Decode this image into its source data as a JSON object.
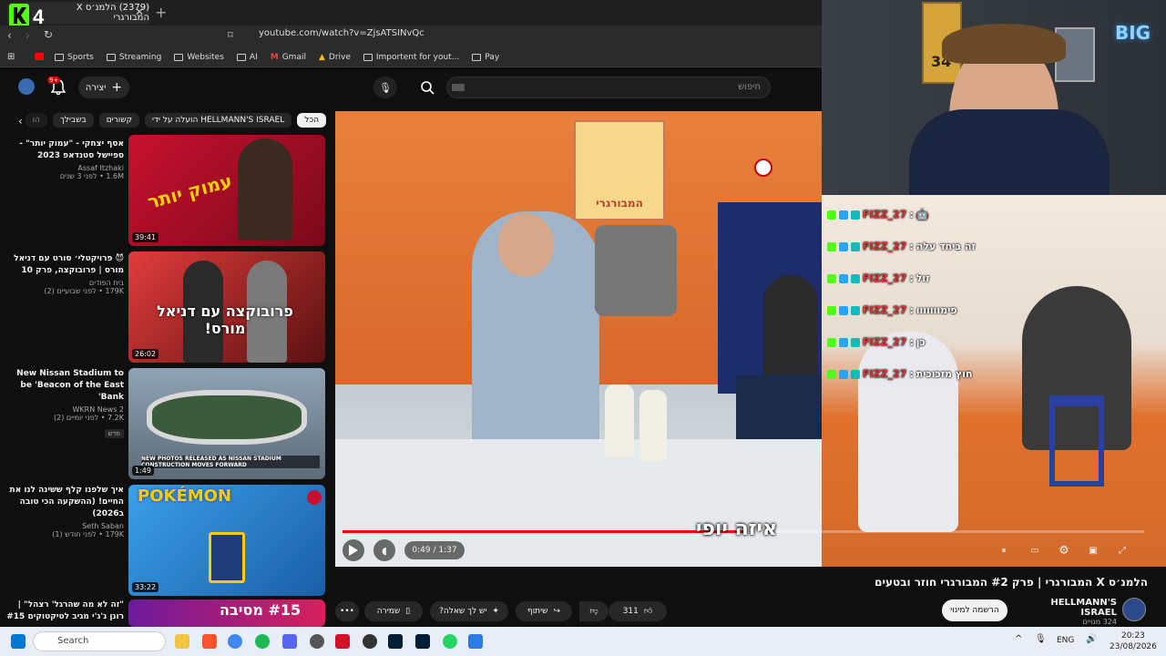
{
  "browser": {
    "tab_title": "(2379) הלמנ׳ס X המבורגרי",
    "address": "youtube.com/watch?v=ZjsATSINvQc",
    "bookmarks": [
      "Sports",
      "Streaming",
      "Websites",
      "AI",
      "Gmail",
      "Drive",
      "Importent for yout...",
      "Pay"
    ]
  },
  "header": {
    "search_placeholder": "חיפוש",
    "create_label": "יצירה",
    "notif_count": "9+"
  },
  "chips": [
    "הכל",
    "HELLMANN'S ISRAEL הועלה על ידי",
    "קשורים",
    "בשבילך",
    "הו"
  ],
  "related": [
    {
      "title": "אסף יצחקי - \"עמוק יותר\" - ספיישל סטנדאפ 2023",
      "channel": "Assaf Itzhaki",
      "stats": "1.6M  •  לפני 3 שנים",
      "duration": "39:41",
      "thumb_text": "עמוק יותר"
    },
    {
      "title": "😈 פרויקטלי׳ סורט עם דניאל מורס | פרובוקצה, פרק 10",
      "channel": "בית הפודים",
      "stats": "179K  •  לפני שבועיים (2)",
      "duration": "26:02",
      "thumb_text": "פרובוקצה עם דניאל מורס!"
    },
    {
      "title": "New Nissan Stadium to be 'Beacon of the East Bank'",
      "channel": "WKRN News 2",
      "stats": "7.2K  •  לפני יומיים (2)",
      "tag": "חדש",
      "duration": "1:49",
      "thumb_text": "NEW PHOTOS RELEASED AS NISSAN STADIUM CONSTRUCTION MOVES FORWARD"
    },
    {
      "title": "איך שלפנו קלף ששינה לנו את החיים! (ההשקעה הכי טובה ב2026)",
      "channel": "Seth Saban",
      "stats": "179K  •  לפני חודש (1)",
      "duration": "33:22",
      "thumb_text": "POKÉMON"
    },
    {
      "title": "\"זה לא מה שהרגל' רצהל\" | רונן ג'ג'י מגיב לטיקטוקים #15",
      "channel": "",
      "stats": "",
      "duration": "",
      "thumb_text": "#15 מסיבה"
    }
  ],
  "player": {
    "time": "0:49 / 1:37",
    "subtitle": "איזה יופי",
    "progress": 0.5,
    "bg_text": "המבורגרי"
  },
  "chat": [
    {
      "user": "FIZZ_27",
      "msg": "🤖"
    },
    {
      "user": "FIZZ_27",
      "msg": "זה ביחד עלה"
    },
    {
      "user": "FIZZ_27",
      "msg": "זול"
    },
    {
      "user": "FIZZ_27",
      "msg": "פימווווווו"
    },
    {
      "user": "FIZZ_27",
      "msg": "כן"
    },
    {
      "user": "FIZZ_27",
      "msg": "חוץ מזכוכית"
    }
  ],
  "webcam": {
    "logo": "BIG"
  },
  "video": {
    "title": "הלמנ׳ס X המבורגרי | פרק #2 המבורגרי חוזר ובטעים",
    "channel": "HELLMANN'S ISRAEL",
    "subs": "324 מנויים",
    "subscribe": "הרשמה למינוי",
    "likes": "311",
    "share": "שיתוף",
    "ask": "יש לך שאלה?",
    "save": "שמירה"
  },
  "taskbar": {
    "search": "Search",
    "lang": "ENG",
    "time": "20:23",
    "date": "23/08/2026"
  }
}
